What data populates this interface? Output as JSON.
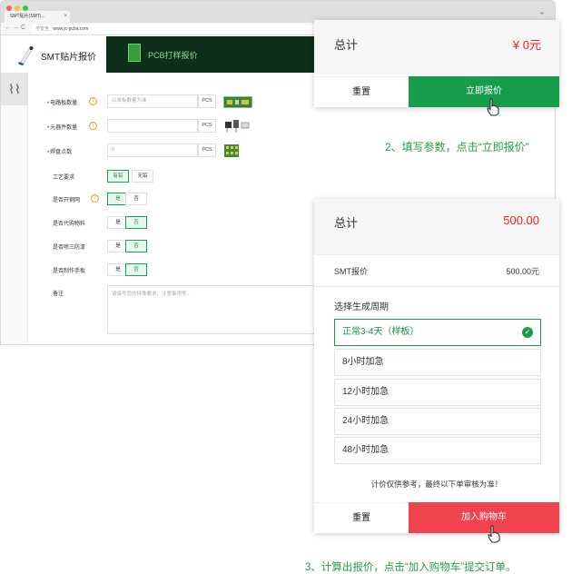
{
  "browser": {
    "tab_title": "SMT贴片(SMT)...",
    "tab_close": "×",
    "new_tab": "+",
    "nav_back": "←",
    "nav_forward": "→",
    "nav_reload": "C",
    "security_label": "不安全",
    "url": "www.jc-pcba.com"
  },
  "header": {
    "smt_tab_label": "SMT贴片报价",
    "pcb_tab_label": "PCB打样报价"
  },
  "form": {
    "rows": [
      {
        "label": "电路板数量",
        "placeholder": "以单板数量为准",
        "unit": "PCS"
      },
      {
        "label": "元器件数量",
        "placeholder": "",
        "unit": "PCS"
      },
      {
        "label": "焊盘点数",
        "placeholder": "0",
        "unit": "PCS"
      }
    ],
    "process": {
      "label": "工艺要求",
      "opt1": "有铅",
      "opt2": "无铅"
    },
    "stencil": {
      "label": "是否开钢网",
      "yes": "是",
      "no": "否"
    },
    "purchase": {
      "label": "是否代购物料",
      "yes": "是",
      "no": "否"
    },
    "coating": {
      "label": "是否喷三防漆",
      "yes": "是",
      "no": "否"
    },
    "sample": {
      "label": "是否制作手板",
      "yes": "是",
      "no": "否"
    },
    "remark": {
      "label": "备注",
      "placeholder": "请填写您的特殊要求、注意事项等..."
    }
  },
  "panel1": {
    "total_label": "总计",
    "amount": "¥ 0元",
    "reset_label": "重置",
    "quote_label": "立即报价"
  },
  "step2": "2、填写参数，点击“立即报价”",
  "panel2": {
    "total_label": "总计",
    "amount": "500.00",
    "smt_label": "SMT报价",
    "smt_amount": "500.00元",
    "cycle_label": "选择生成周期",
    "options": [
      "正常3-4天（样板）",
      "8小时加急",
      "12小时加急",
      "24小时加急",
      "48小时加急"
    ],
    "note": "计价仅供参考，最终以下单审核为准！",
    "reset_label": "重置",
    "cart_label": "加入购物车"
  },
  "step3": "3、计算出报价，点击“加入购物车”提交订单。",
  "colors": {
    "green": "#169c4a",
    "red": "#f1434e",
    "dark_green": "#0e2f1a"
  }
}
